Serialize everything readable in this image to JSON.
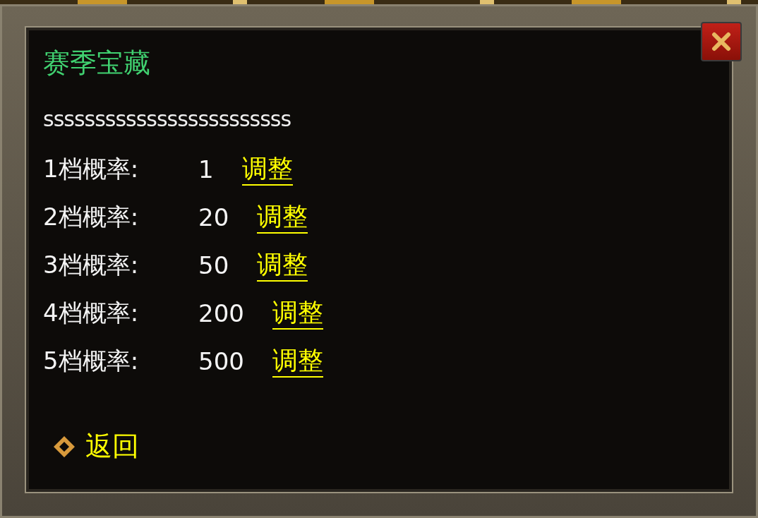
{
  "window": {
    "title": "赛季宝藏"
  },
  "info": "ssssssssssssssssssssssss",
  "rows": [
    {
      "label": "1档概率:",
      "value": "1",
      "action": "调整"
    },
    {
      "label": "2档概率:",
      "value": "20",
      "action": "调整"
    },
    {
      "label": "3档概率:",
      "value": "50",
      "action": "调整"
    },
    {
      "label": "4档概率:",
      "value": "200",
      "action": "调整"
    },
    {
      "label": "5档概率:",
      "value": "500",
      "action": "调整"
    }
  ],
  "back": {
    "label": "返回"
  }
}
